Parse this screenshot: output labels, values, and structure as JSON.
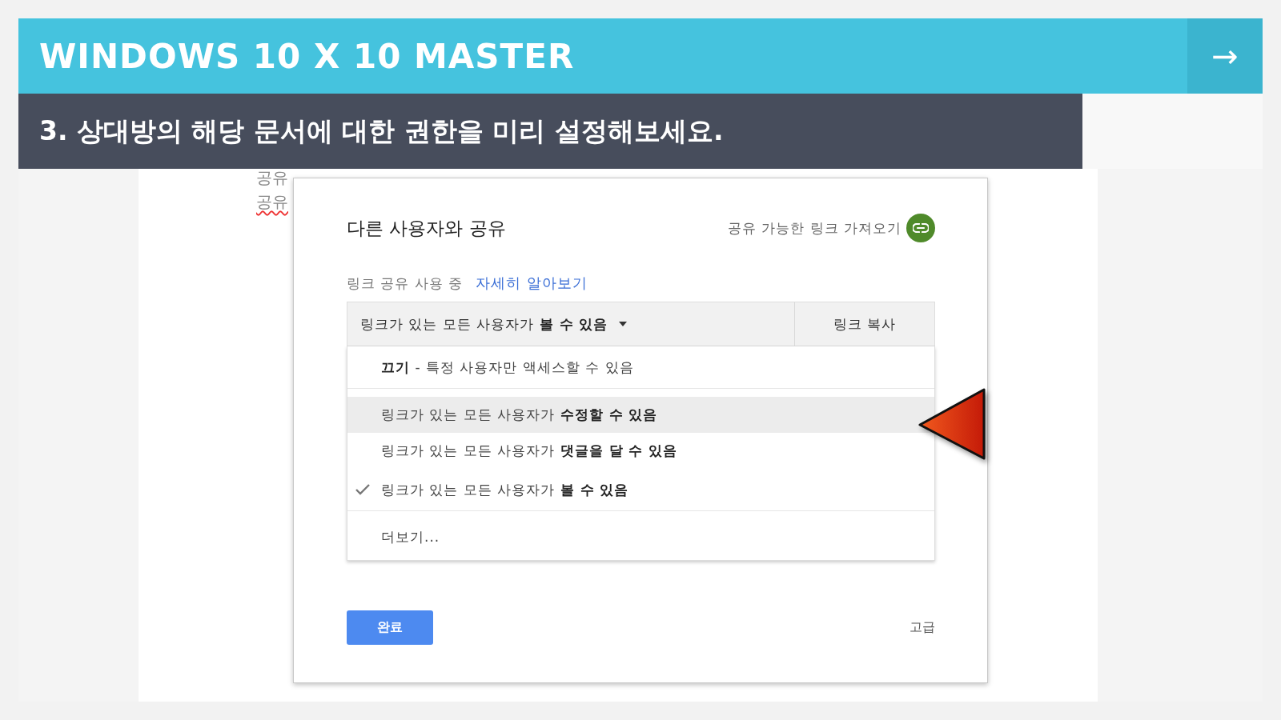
{
  "header": {
    "title": "WINDOWS 10 X 10 MASTER",
    "next_button": "→"
  },
  "subtitle": "3. 상대방의 해당 문서에 대한 권한을 미리 설정해보세요.",
  "document": {
    "lines": [
      {
        "text": "공유",
        "misspelled": false
      },
      {
        "text": "공유",
        "misspelled": true
      }
    ]
  },
  "dialog": {
    "title": "다른 사용자와 공유",
    "get_link": "공유 가능한 링크 가져오기",
    "link_status": "링크 공유 사용 중",
    "learn_more": "자세히 알아보기",
    "access_dropdown": "링크가 있는 모든 사용자가 **볼 수 있음**",
    "copy_link": "링크 복사",
    "menu": [
      {
        "text": "**끄기** - 특정 사용자만 액세스할 수 있음",
        "selected": false,
        "highlighted": false,
        "divider_after": true
      },
      {
        "text": "링크가 있는 모든 사용자가 **수정할 수 있음**",
        "selected": false,
        "highlighted": true,
        "divider_after": false
      },
      {
        "text": "링크가 있는 모든 사용자가 **댓글을 달 수 있음**",
        "selected": false,
        "highlighted": false,
        "divider_after": false
      },
      {
        "text": "링크가 있는 모든 사용자가 **볼 수 있음**",
        "selected": true,
        "highlighted": false,
        "divider_after": true
      },
      {
        "text": "더보기...",
        "selected": false,
        "highlighted": false,
        "divider_after": false
      }
    ],
    "done": "완료",
    "advanced": "고급"
  }
}
